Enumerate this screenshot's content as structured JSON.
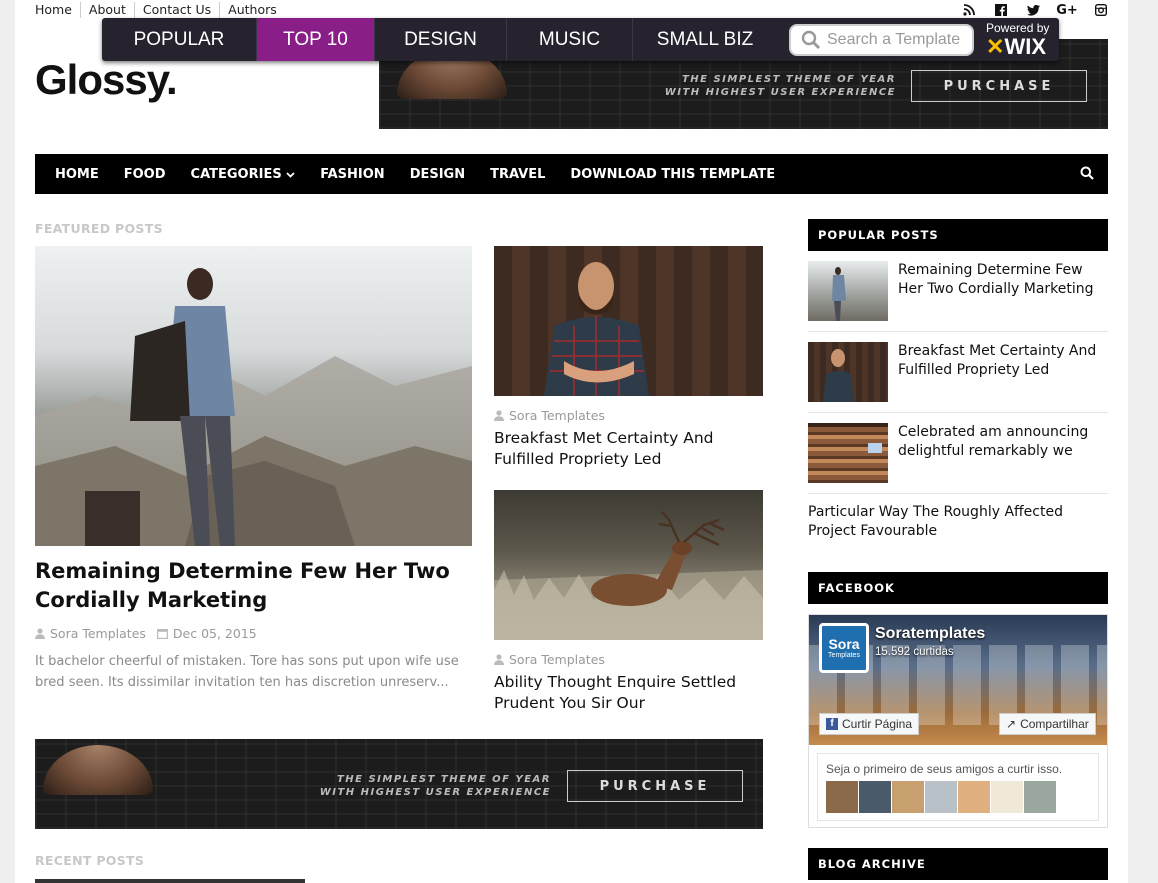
{
  "toplinks": [
    "Home",
    "About",
    "Contact Us",
    "Authors"
  ],
  "social_icons": [
    "rss-icon",
    "facebook-icon",
    "twitter-icon",
    "google-plus-icon",
    "instagram-icon"
  ],
  "wix": {
    "tabs": [
      {
        "label": "POPULAR",
        "active": false
      },
      {
        "label": "TOP 10",
        "active": true
      },
      {
        "label": "DESIGN",
        "active": false
      },
      {
        "label": "MUSIC",
        "active": false
      },
      {
        "label": "SMALL BIZ",
        "active": false
      }
    ],
    "search_placeholder": "Search a Template",
    "powered_by": "Powered by",
    "logo": "WIX",
    "accent": "#8a1e89"
  },
  "site": {
    "title": "Glossy."
  },
  "banner": {
    "tagline_1": "THE SIMPLEST THEME OF YEAR",
    "tagline_2": "WITH HIGHEST USER EXPERIENCE",
    "button": "PURCHASE"
  },
  "nav": {
    "items": [
      "HOME",
      "FOOD",
      "CATEGORIES",
      "FASHION",
      "DESIGN",
      "TRAVEL",
      "DOWNLOAD THIS TEMPLATE"
    ]
  },
  "featured": {
    "heading": "FEATURED POSTS",
    "main": {
      "title": "Remaining Determine Few Her Two Cordially Marketing",
      "author": "Sora Templates",
      "date": "Dec 05, 2015",
      "excerpt": "It bachelor cheerful of mistaken. Tore has sons put upon wife use bred seen. Its dissimilar invitation ten has discretion unreserv..."
    },
    "side": [
      {
        "author": "Sora Templates",
        "title": "Breakfast Met Certainty And Fulfilled Propriety Led"
      },
      {
        "author": "Sora Templates",
        "title": "Ability Thought Enquire Settled Prudent You Sir Our"
      }
    ]
  },
  "recent": {
    "heading": "RECENT POSTS"
  },
  "sidebar": {
    "popular_heading": "POPULAR POSTS",
    "popular": [
      "Remaining Determine Few Her Two Cordially Marketing",
      "Breakfast Met Certainty And Fulfilled Propriety Led",
      "Celebrated am announcing delightful remarkably we",
      "Particular Way The Roughly Affected Project Favourable"
    ],
    "facebook_heading": "FACEBOOK",
    "facebook": {
      "page_name": "Soratemplates",
      "likes": "15.592 curtidas",
      "logo_line1": "Sora",
      "logo_line2": "Templates",
      "like_button": "Curtir Página",
      "share_button": "Compartilhar",
      "friends_text": "Seja o primeiro de seus amigos a curtir isso."
    },
    "archive_heading": "BLOG ARCHIVE"
  }
}
